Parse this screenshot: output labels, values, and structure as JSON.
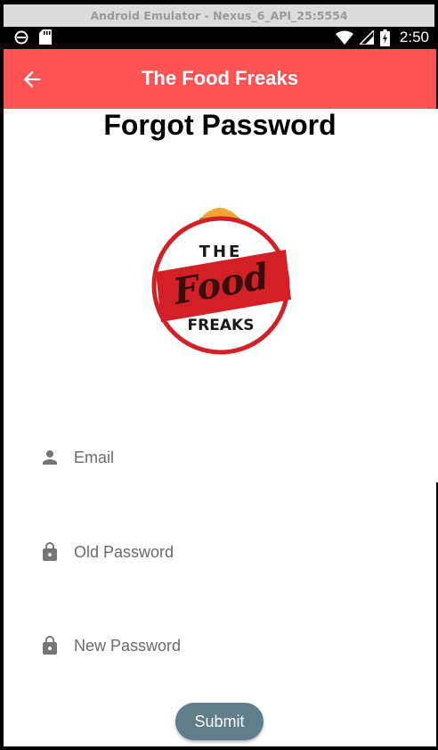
{
  "emulator": {
    "title": "Android Emulator - Nexus_6_API_25:5554"
  },
  "status_bar": {
    "time": "2:50"
  },
  "app_bar": {
    "title": "The Food Freaks"
  },
  "page": {
    "title": "Forgot Password"
  },
  "logo": {
    "line1": "THE",
    "line2": "Food",
    "line3": "FREAKS"
  },
  "form": {
    "email": {
      "placeholder": "Email",
      "icon": "person-icon"
    },
    "old_password": {
      "placeholder": "Old Password",
      "icon": "lock-icon"
    },
    "new_password": {
      "placeholder": "New Password",
      "icon": "lock-icon"
    },
    "submit_label": "Submit"
  },
  "colors": {
    "app_bar": "#ff5252",
    "submit_button": "#607d8b",
    "logo_red": "#d32027"
  }
}
